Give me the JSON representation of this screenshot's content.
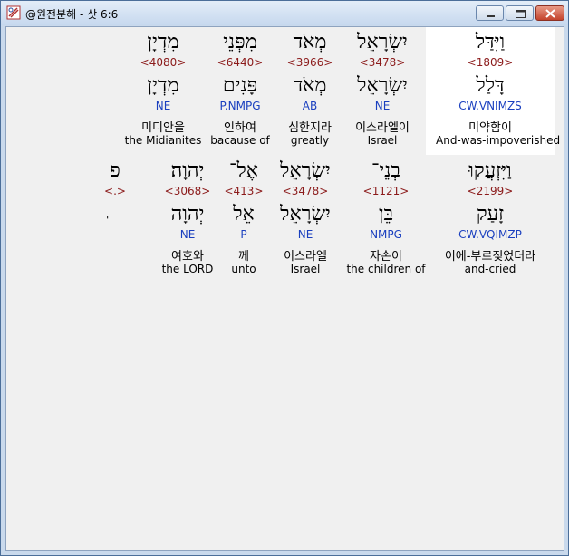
{
  "window": {
    "title": "@원전분해 - 삿 6:6"
  },
  "row1": [
    {
      "surface": "וַיִּדַּל",
      "strong": "<1809>",
      "lemma": "דָּלַל",
      "morph": "CW.VNIMZS",
      "korean": "미약함이",
      "english": "And-was-impoverished"
    },
    {
      "surface": "יִשְׂרָאֵל",
      "strong": "<3478>",
      "lemma": "יִשְׂרָאֵל",
      "morph": "NE",
      "korean": "이스라엘이",
      "english": "Israel"
    },
    {
      "surface": "מְאֹד",
      "strong": "<3966>",
      "lemma": "מְאֹד",
      "morph": "AB",
      "korean": "심한지라",
      "english": "greatly"
    },
    {
      "surface": "מִפְּנֵי",
      "strong": "<6440>",
      "lemma": "פָּנִים",
      "morph": "P.NMPG",
      "korean": "인하여",
      "english": "bacause of"
    },
    {
      "surface": "מִדְיָן",
      "strong": "<4080>",
      "lemma": "מִדְיָן",
      "morph": "NE",
      "korean": "미디안을",
      "english": "the Midianites"
    }
  ],
  "row2": [
    {
      "surface": "וַיִּזְעֲקוּ",
      "strong": "<2199>",
      "lemma": "זָעַק",
      "morph": "CW.VQIMZP",
      "korean": "이에-부르짖었더라",
      "english": "and-cried"
    },
    {
      "surface": "בְנֵי־",
      "strong": "<1121>",
      "lemma": "בֵּן",
      "morph": "NMPG",
      "korean": "자손이",
      "english": "the children of"
    },
    {
      "surface": "יִשְׂרָאֵל",
      "strong": "<3478>",
      "lemma": "יִשְׂרָאֵל",
      "morph": "NE",
      "korean": "이스라엘",
      "english": "Israel"
    },
    {
      "surface": "אֶל־",
      "strong": "<413>",
      "lemma": "אֵל",
      "morph": "P",
      "korean": "께",
      "english": "unto"
    },
    {
      "surface": "יְהוָה׃",
      "strong": "<3068>",
      "lemma": "יְהוָה",
      "morph": "NE",
      "korean": "여호와",
      "english": "the LORD"
    },
    {
      "surface": "פ",
      "strong": "<.>",
      "tick": "'"
    }
  ]
}
